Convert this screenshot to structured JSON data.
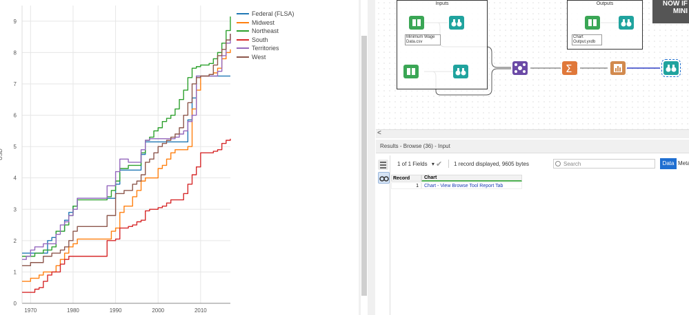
{
  "chart_data": {
    "type": "line",
    "title": "",
    "xlabel": "",
    "ylabel": "USD",
    "xlim": [
      1968,
      2017
    ],
    "ylim": [
      0,
      9.5
    ],
    "x_ticks": [
      "1970",
      "1980",
      "1990",
      "2000",
      "2010"
    ],
    "y_ticks": [
      "0",
      "1",
      "2",
      "3",
      "4",
      "5",
      "6",
      "7",
      "8",
      "9"
    ],
    "grid": true,
    "legend": "top-right",
    "x": [
      1968,
      1969,
      1970,
      1971,
      1972,
      1973,
      1974,
      1975,
      1976,
      1977,
      1978,
      1979,
      1980,
      1981,
      1982,
      1983,
      1984,
      1985,
      1986,
      1987,
      1988,
      1989,
      1990,
      1991,
      1992,
      1993,
      1994,
      1995,
      1996,
      1997,
      1998,
      1999,
      2000,
      2001,
      2002,
      2003,
      2004,
      2005,
      2006,
      2007,
      2008,
      2009,
      2010,
      2011,
      2012,
      2013,
      2014,
      2015,
      2016,
      2017
    ],
    "series": [
      {
        "name": "Federal (FLSA)",
        "color": "#1f77b4",
        "values": [
          1.6,
          1.6,
          1.6,
          1.6,
          1.6,
          1.6,
          2.0,
          2.1,
          2.3,
          2.3,
          2.65,
          2.9,
          3.1,
          3.35,
          3.35,
          3.35,
          3.35,
          3.35,
          3.35,
          3.35,
          3.35,
          3.35,
          3.8,
          4.25,
          4.25,
          4.25,
          4.25,
          4.25,
          4.75,
          5.15,
          5.15,
          5.15,
          5.15,
          5.15,
          5.15,
          5.15,
          5.15,
          5.15,
          5.15,
          5.85,
          6.55,
          7.25,
          7.25,
          7.25,
          7.25,
          7.25,
          7.25,
          7.25,
          7.25,
          7.25
        ]
      },
      {
        "name": "Midwest",
        "color": "#ff7f0e",
        "values": [
          0.7,
          0.7,
          0.8,
          0.8,
          0.9,
          1.0,
          1.0,
          1.0,
          1.2,
          1.4,
          1.6,
          1.8,
          1.9,
          2.05,
          2.05,
          2.05,
          2.05,
          2.05,
          2.05,
          2.05,
          2.05,
          2.3,
          2.4,
          2.9,
          3.1,
          3.1,
          3.4,
          3.6,
          3.9,
          4.0,
          4.0,
          4.0,
          4.3,
          4.4,
          4.6,
          4.8,
          4.9,
          4.9,
          4.9,
          5.0,
          6.2,
          6.8,
          7.25,
          7.25,
          7.3,
          7.35,
          7.5,
          7.8,
          8.0,
          8.1
        ]
      },
      {
        "name": "Northeast",
        "color": "#2ca02c",
        "values": [
          1.5,
          1.5,
          1.5,
          1.6,
          1.6,
          1.7,
          1.7,
          1.8,
          2.3,
          2.3,
          2.5,
          2.8,
          3.1,
          3.3,
          3.3,
          3.3,
          3.3,
          3.3,
          3.3,
          3.3,
          3.4,
          3.6,
          3.9,
          4.3,
          4.3,
          4.4,
          4.4,
          4.4,
          4.8,
          5.2,
          5.3,
          5.5,
          5.6,
          5.8,
          5.9,
          6.0,
          6.2,
          6.5,
          6.8,
          7.2,
          7.5,
          7.55,
          7.6,
          7.6,
          7.65,
          7.8,
          8.0,
          8.3,
          8.7,
          9.15
        ]
      },
      {
        "name": "South",
        "color": "#d62728",
        "values": [
          0.35,
          0.35,
          0.35,
          0.45,
          0.5,
          0.7,
          0.9,
          1.0,
          1.0,
          1.25,
          1.4,
          1.5,
          1.5,
          1.5,
          1.5,
          1.5,
          1.5,
          1.5,
          1.5,
          1.5,
          2.0,
          2.0,
          2.05,
          2.4,
          2.4,
          2.45,
          2.5,
          2.6,
          2.65,
          2.95,
          3.0,
          3.0,
          3.05,
          3.1,
          3.2,
          3.3,
          3.3,
          3.3,
          3.5,
          3.8,
          4.1,
          4.35,
          4.8,
          4.8,
          4.8,
          4.85,
          4.9,
          5.1,
          5.2,
          5.25
        ]
      },
      {
        "name": "Territories",
        "color": "#9467bd",
        "values": [
          1.4,
          1.5,
          1.7,
          1.8,
          1.8,
          1.9,
          1.9,
          1.9,
          2.2,
          2.5,
          2.6,
          2.8,
          3.0,
          3.35,
          3.35,
          3.35,
          3.35,
          3.35,
          3.35,
          3.35,
          3.75,
          3.75,
          4.2,
          4.6,
          4.6,
          4.5,
          4.5,
          4.5,
          4.9,
          5.2,
          5.25,
          5.25,
          5.25,
          5.25,
          5.25,
          5.25,
          5.3,
          5.4,
          5.5,
          5.8,
          6.0,
          7.25,
          7.25,
          7.25,
          7.25,
          7.25,
          7.4,
          7.9,
          8.3,
          8.6
        ]
      },
      {
        "name": "West",
        "color": "#8c564b",
        "values": [
          1.2,
          1.2,
          1.3,
          1.3,
          1.3,
          1.5,
          1.5,
          1.6,
          1.6,
          1.7,
          1.8,
          2.0,
          2.3,
          2.45,
          2.45,
          2.45,
          2.45,
          2.45,
          2.45,
          2.45,
          2.8,
          2.8,
          3.5,
          3.5,
          3.6,
          3.6,
          3.8,
          3.9,
          4.1,
          4.5,
          4.6,
          4.8,
          5.0,
          5.1,
          5.2,
          5.3,
          5.4,
          5.6,
          6.0,
          6.4,
          7.0,
          7.2,
          7.25,
          7.25,
          7.3,
          7.6,
          7.9,
          8.1,
          8.4,
          8.6
        ]
      }
    ]
  },
  "workflow": {
    "containers": [
      {
        "title": "Inputs"
      },
      {
        "title": "Outputs"
      }
    ],
    "labels": {
      "input1": "Minimum Wage Data.csv",
      "output1": "Chart Output.yxdb"
    },
    "meme_text": "NOW IF MINI",
    "hscroll_left": "<"
  },
  "results": {
    "header": "Results - Browse (36) - Input",
    "fields_label": "1 of 1 Fields",
    "dropdown_arrow": "▾",
    "record_info": "1 record displayed, 9605 bytes",
    "search_placeholder": "Search",
    "data_tab": "Data",
    "meta_tab": "Meta",
    "columns": [
      "Record",
      "Chart"
    ],
    "rows": [
      {
        "record": "1",
        "chart": "Chart - View Browse Tool Report Tab"
      }
    ]
  },
  "colors": {
    "tool_teal": "#20a39e",
    "tool_green": "#3aa655",
    "tool_purple": "#6b4aa6",
    "tool_orange": "#e0783a",
    "tool_brown": "#d28a4e",
    "accent_blue": "#1f6fd1"
  }
}
